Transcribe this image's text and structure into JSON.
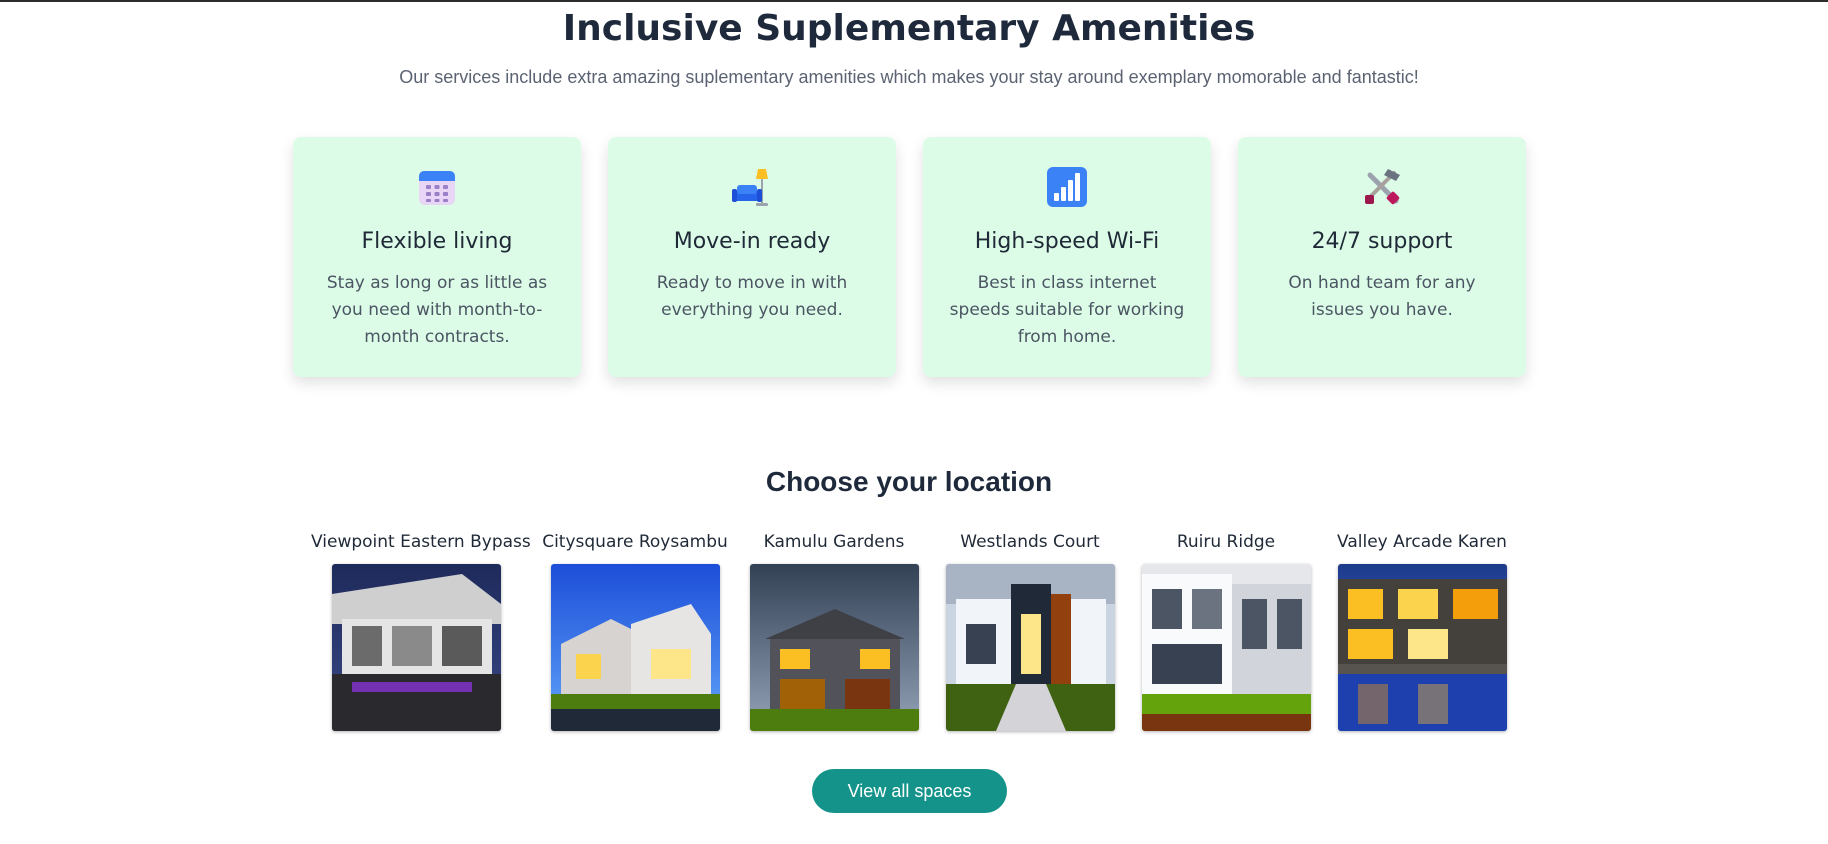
{
  "section_title": "Inclusive Suplementary Amenities",
  "section_subtitle": "Our services include extra amazing suplementary amenities which makes your stay around exemplary momorable and fantastic!",
  "amenities": [
    {
      "icon": "calendar-icon",
      "title": "Flexible living",
      "description": "Stay as long or as little as you need with month-to-month contracts."
    },
    {
      "icon": "couch-lamp-icon",
      "title": "Move-in ready",
      "description": "Ready to move in with everything you need."
    },
    {
      "icon": "signal-bars-icon",
      "title": "High-speed Wi-Fi",
      "description": "Best in class internet speeds suitable for working from home."
    },
    {
      "icon": "tools-icon",
      "title": "24/7 support",
      "description": "On hand team for any issues you have."
    }
  ],
  "locations_title": "Choose your location",
  "locations": [
    {
      "name": "Viewpoint Eastern Bypass"
    },
    {
      "name": "Citysquare Roysambu"
    },
    {
      "name": "Kamulu Gardens"
    },
    {
      "name": "Westlands Court"
    },
    {
      "name": "Ruiru Ridge"
    },
    {
      "name": "Valley Arcade Karen"
    }
  ],
  "view_all_label": "View all spaces",
  "colors": {
    "card_bg": "#dcfce7",
    "button_bg": "#13938a",
    "heading": "#1e2a3b"
  }
}
